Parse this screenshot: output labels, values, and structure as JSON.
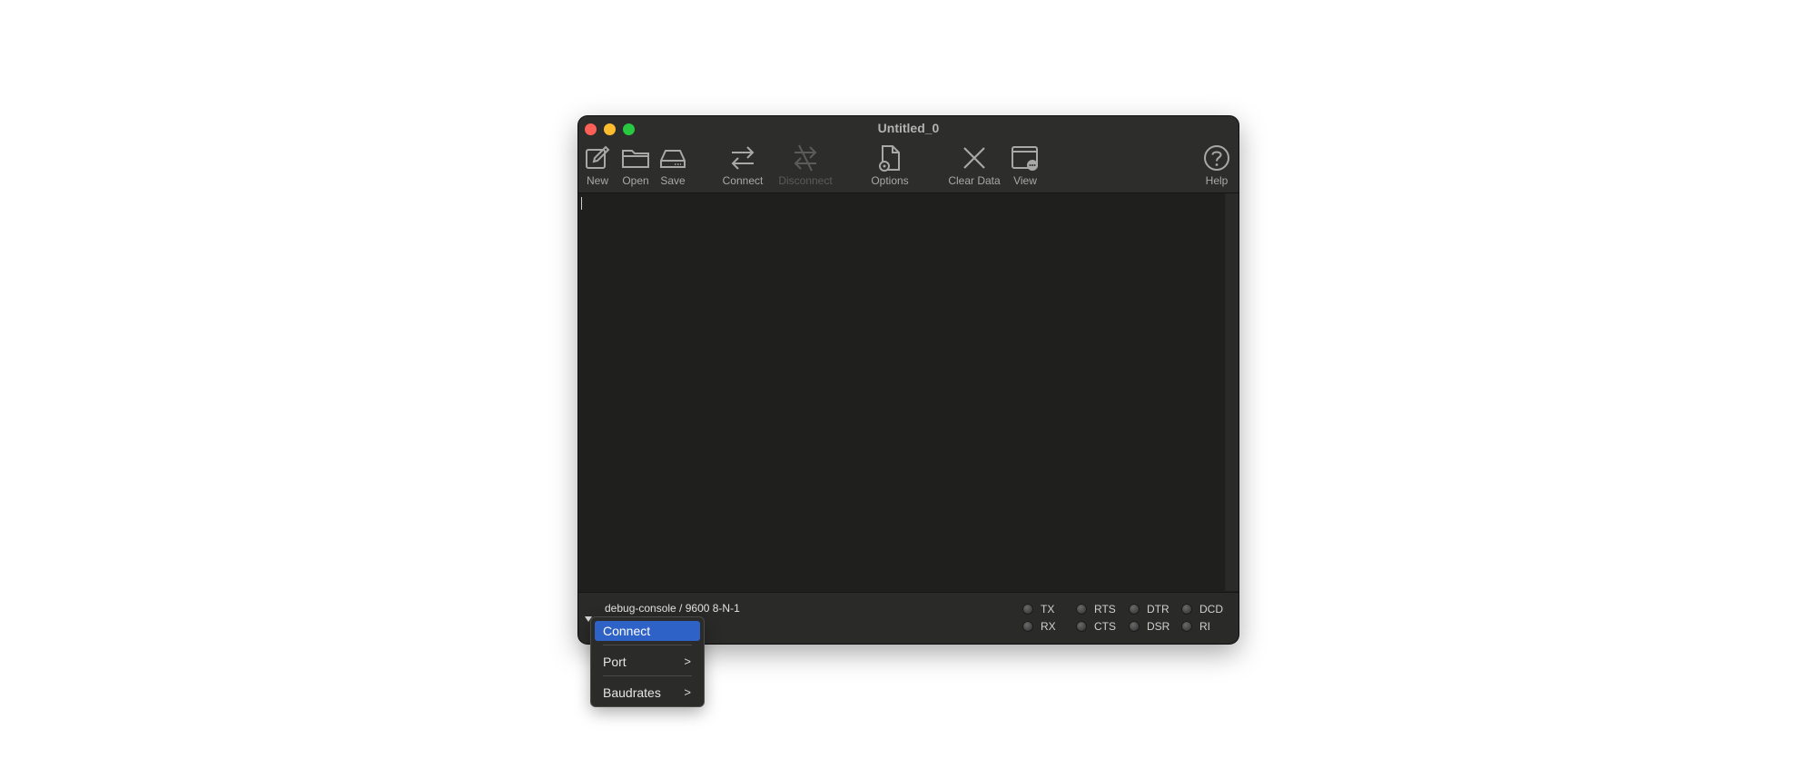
{
  "window": {
    "title": "Untitled_0"
  },
  "toolbar": {
    "new_label": "New",
    "open_label": "Open",
    "save_label": "Save",
    "connect_label": "Connect",
    "disconnect_label": "Disconnect",
    "options_label": "Options",
    "clear_label": "Clear Data",
    "view_label": "View",
    "help_label": "Help"
  },
  "status": {
    "text": "debug-console / 9600 8-N-1",
    "leds": {
      "tx": "TX",
      "rx": "RX",
      "rts": "RTS",
      "cts": "CTS",
      "dtr": "DTR",
      "dsr": "DSR",
      "dcd": "DCD",
      "ri": "RI"
    }
  },
  "menu": {
    "items": [
      {
        "label": "Connect",
        "selected": true
      },
      {
        "label": "Port",
        "submenu": true
      },
      {
        "label": "Baudrates",
        "submenu": true
      }
    ]
  },
  "colors": {
    "window_bg": "#1f1f1d",
    "toolbar_bg": "#2d2d2c",
    "selection": "#2f62c7"
  }
}
